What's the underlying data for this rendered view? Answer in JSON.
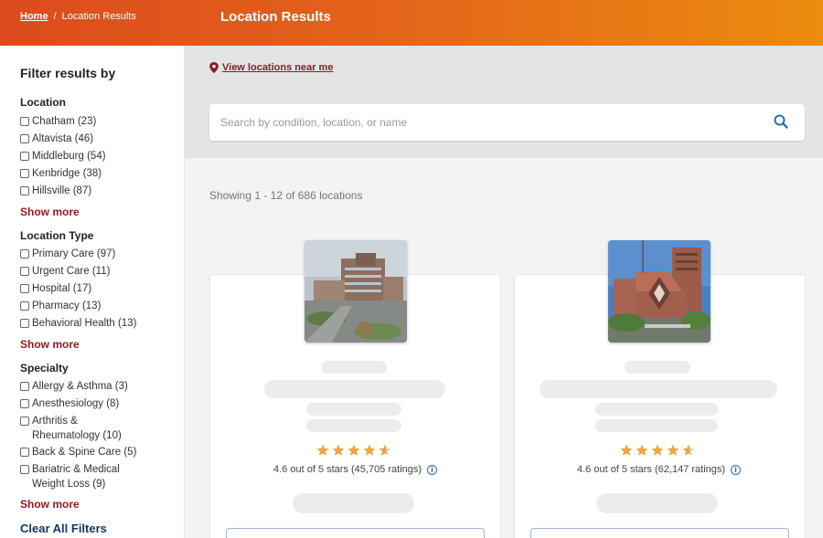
{
  "header": {
    "breadcrumb_home": "Home",
    "breadcrumb_sep": "/",
    "breadcrumb_current": "Location Results",
    "page_title": "Location Results"
  },
  "sidebar": {
    "title": "Filter results by",
    "groups": [
      {
        "title": "Location",
        "options": [
          "Chatham (23)",
          "Altavista (46)",
          "Middleburg (54)",
          "Kenbridge (38)",
          "Hillsville (87)"
        ],
        "show_more": "Show more"
      },
      {
        "title": "Location Type",
        "options": [
          "Primary Care (97)",
          "Urgent Care (11)",
          "Hospital (17)",
          "Pharmacy (13)",
          "Behavioral Health (13)"
        ],
        "show_more": "Show more"
      },
      {
        "title": "Specialty",
        "options": [
          "Allergy & Asthma (3)",
          "Anesthesiology (8)",
          "Arthritis & Rheumatology (10)",
          "Back & Spine Care (5)",
          "Bariatric & Medical Weight Loss (9)"
        ],
        "show_more": "Show more"
      }
    ],
    "clear_all": "Clear All Filters"
  },
  "search": {
    "near_me": "View locations near me",
    "placeholder": "Search by condition, location, or name",
    "value": ""
  },
  "results": {
    "showing": "Showing 1 - 12 of 686 locations",
    "cards": [
      {
        "rating": 4.6,
        "rating_text": "4.6 out of 5 stars (45,705 ratings)"
      },
      {
        "rating": 4.6,
        "rating_text": "4.6 out of 5 stars (62,147 ratings)"
      }
    ]
  },
  "colors": {
    "header_start": "#dc4a1d",
    "header_end": "#ec8c10",
    "accent_red": "#8c1c24",
    "link_blue": "#14375f",
    "star": "#f3a43a"
  },
  "icons": {
    "pin": "map-pin-icon",
    "search": "search-icon",
    "info": "info-icon",
    "star": "star-icon"
  }
}
